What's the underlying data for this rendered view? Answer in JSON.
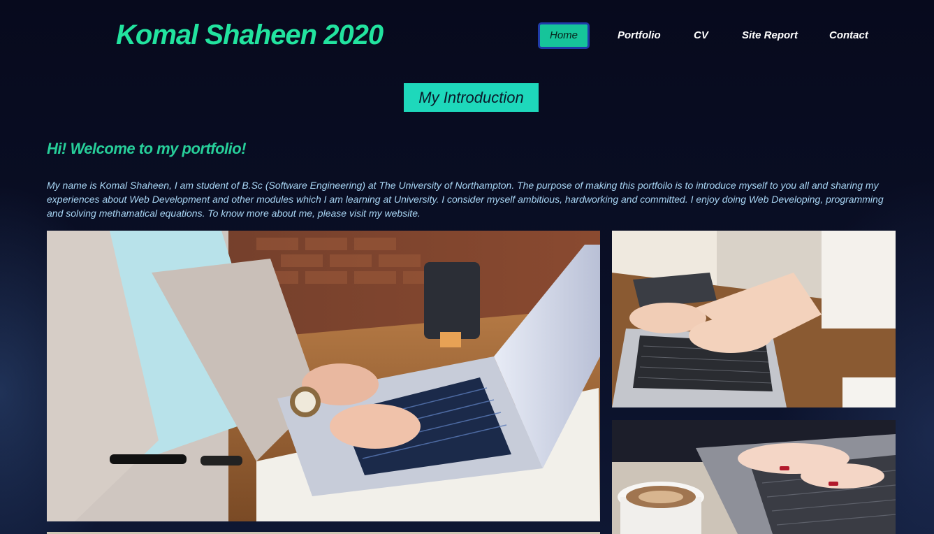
{
  "header": {
    "site_title": "Komal Shaheen 2020"
  },
  "nav": {
    "items": [
      {
        "label": "Home",
        "active": true
      },
      {
        "label": "Portfolio"
      },
      {
        "label": "CV"
      },
      {
        "label": "Site Report"
      },
      {
        "label": "Contact"
      }
    ]
  },
  "main": {
    "section_title": "My Introduction",
    "welcome_heading": "Hi! Welcome to my portfolio!",
    "intro_text": "My name is Komal Shaheen, I am student of B.Sc (Software Engineering) at The University of Northampton. The purpose of making this portfoilo is to introduce myself to you all and sharing my experiences about Web Development and other modules which I am learning at University. I consider myself ambitious, hardworking and committed. I enjoy doing Web Developing, programming and solving methamatical equations. To know more about me, please visit my website."
  },
  "colors": {
    "accent": "#22e39f",
    "badge": "#1ed8bb",
    "nav_active": "#16c49a",
    "body_text": "#a9d6f5",
    "background": "#070a1d"
  },
  "images": [
    {
      "name": "laptop-typing-photo-main"
    },
    {
      "name": "laptop-typing-photo-side"
    },
    {
      "name": "coffee-laptop-photo-side"
    }
  ]
}
